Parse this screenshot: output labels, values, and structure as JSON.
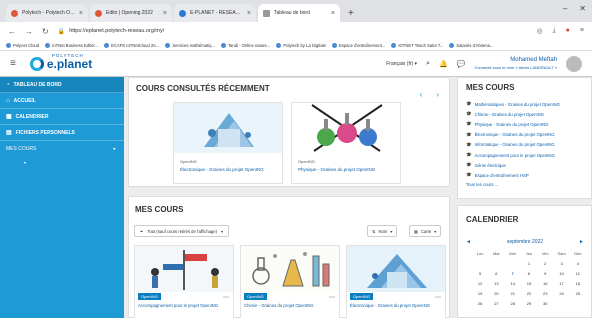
{
  "browser": {
    "tabs": [
      {
        "label": "Polytech - Polytech Ocean",
        "active": false
      },
      {
        "label": "Édito | Opening 2022",
        "active": false
      },
      {
        "label": "E-PLANET - RESEAU POLYTECH",
        "active": false
      },
      {
        "label": "Tableau de bord",
        "active": true
      }
    ],
    "url": "https://eplanet.polytech-reseau.org/my/",
    "bookmarks": [
      "Polynet Cloud",
      "IoTNet Business Editor...",
      "ECAFE IoTNetCloud Ze...",
      "Services mathématiq...",
      "Tandi - Online nature...",
      "Polytech by La Digitale",
      "Espace d'entraînement...",
      "IOTNET Teach Salut T...",
      "Salariés d'Ahsena..."
    ]
  },
  "header": {
    "logo_sup": "POLYTECH",
    "logo_text": "e.planet",
    "language": "Français (fr) ▾",
    "user_name": "Mohamed Meftah",
    "user_sub": "Connecté sous le nom « Alexis LANDRAULT »"
  },
  "sidebar": {
    "items": [
      {
        "label": "TABLEAU DE BORD",
        "icon": "dashboard-icon"
      },
      {
        "label": "ACCUEIL",
        "icon": "home-icon"
      },
      {
        "label": "CALENDRIER",
        "icon": "calendar-icon"
      },
      {
        "label": "FICHIERS PERSONNELS",
        "icon": "file-icon"
      }
    ],
    "section": "MES COURS",
    "sub": "•"
  },
  "recent": {
    "title": "COURS CONSULTÉS RÉCEMMENT",
    "cards": [
      {
        "category": "OpenING",
        "title": "Électronique - Graines du projet OpenING"
      },
      {
        "category": "OpenING",
        "title": "Physique - Graines du projet OpenING"
      }
    ]
  },
  "courses": {
    "title": "MES COURS",
    "filter": "Tout (sauf cours retirés de l'affichage)",
    "sort": "Nom",
    "view": "Carte",
    "cards": [
      {
        "badge": "OpenING",
        "title": "Accompagnement pour le projet OpenING"
      },
      {
        "badge": "OpenING",
        "title": "Chimie - Graines du projet OpenING"
      },
      {
        "badge": "OpenING",
        "title": "Électronique - Graines du projet OpenING"
      }
    ]
  },
  "side_courses": {
    "title": "MES COURS",
    "items": [
      "Mathématiques - Graines du projet OpenING",
      "Chimie - Graines du projet OpenING",
      "Physique - Graines du projet OpenING",
      "Électronique - Graines du projet OpenING",
      "Informatique - Graines du projet OpenING",
      "Accompagnement pour le projet OpenING",
      "Génie électrique",
      "Espace d'entraînement HSP"
    ],
    "more": "Tous les cours ..."
  },
  "calendar": {
    "title": "CALENDRIER",
    "month": "septembre 2022",
    "prev": "◄",
    "next": "►",
    "weekdays": [
      "Lun",
      "Mar",
      "Mer",
      "Jeu",
      "Ven",
      "Sam",
      "Dim"
    ],
    "days": [
      "",
      "",
      "",
      "1",
      "2",
      "3",
      "4",
      "5",
      "6",
      "7",
      "8",
      "9",
      "10",
      "11",
      "12",
      "13",
      "14",
      "15",
      "16",
      "17",
      "18",
      "19",
      "20",
      "21",
      "22",
      "23",
      "24",
      "25",
      "26",
      "27",
      "28",
      "29",
      "30",
      ""
    ],
    "today": "7"
  },
  "colors": {
    "sidebar": "#1e9ad6",
    "link": "#0b5da8",
    "badge": "#0b7ec2"
  }
}
